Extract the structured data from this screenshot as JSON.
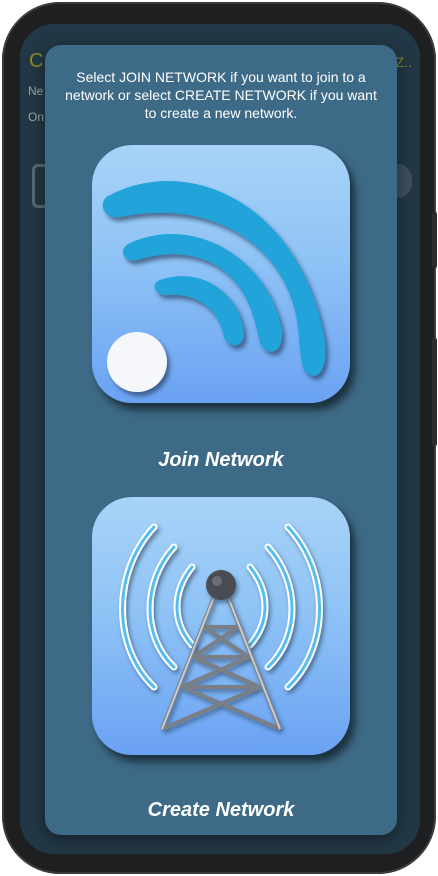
{
  "background_app": {
    "title_fragment": "C",
    "title_right_fragment": "Z..",
    "line1_fragment": "Ne",
    "line2_fragment": "On"
  },
  "dialog": {
    "instruction": "Select JOIN NETWORK if you want to join to a network or select CREATE NETWORK if you want to create a new network.",
    "options": [
      {
        "label": "Join Network",
        "icon": "wifi-signal-icon"
      },
      {
        "label": "Create Network",
        "icon": "radio-tower-icon"
      }
    ]
  },
  "colors": {
    "dialog_background": "#3d6a86",
    "tile_gradient_top": "#a7d3f7",
    "tile_gradient_bottom": "#6aa2f3",
    "wave_blue": "#1b9fd6"
  }
}
